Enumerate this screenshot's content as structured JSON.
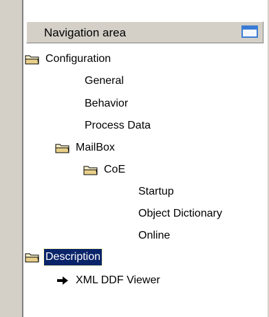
{
  "navigation": {
    "title": "Navigation area",
    "button_icon": "window-icon"
  },
  "tree": [
    {
      "id": "configuration",
      "label": "Configuration",
      "icon": "folder-icon",
      "level": 0
    },
    {
      "id": "general",
      "label": "General",
      "icon": "",
      "level": 1
    },
    {
      "id": "behavior",
      "label": "Behavior",
      "icon": "",
      "level": 1
    },
    {
      "id": "process-data",
      "label": "Process Data",
      "icon": "",
      "level": 1
    },
    {
      "id": "mailbox",
      "label": "MailBox",
      "icon": "folder-icon",
      "level": 1
    },
    {
      "id": "coe",
      "label": "CoE",
      "icon": "folder-icon",
      "level": 2
    },
    {
      "id": "startup",
      "label": "Startup",
      "icon": "",
      "level": 3
    },
    {
      "id": "object-dictionary",
      "label": "Object Dictionary",
      "icon": "",
      "level": 3
    },
    {
      "id": "online",
      "label": "Online",
      "icon": "",
      "level": 3
    },
    {
      "id": "description",
      "label": "Description",
      "icon": "folder-icon",
      "level": 0,
      "selected": true
    },
    {
      "id": "xml-ddf-viewer",
      "label": "XML DDF Viewer",
      "icon": "arrow-right-icon",
      "level": 1
    }
  ],
  "colors": {
    "selection": "#0a246a",
    "window_button": "#3a7bd5",
    "folder": "#e9d08a"
  }
}
